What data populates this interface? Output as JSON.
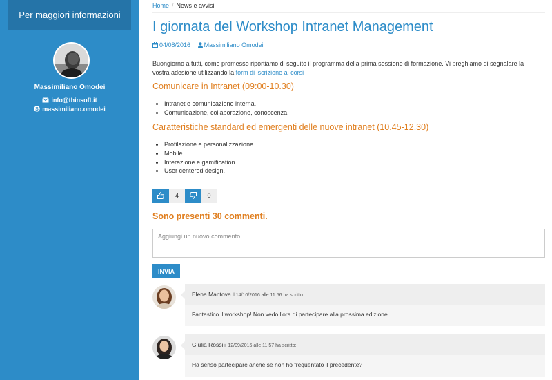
{
  "sidebar": {
    "header": "Per maggiori informazioni",
    "profile_name": "Massimiliano Omodei",
    "email": "info@thinsoft.it",
    "skype": "massimiliano.omodei",
    "accent": "#2d8cc8",
    "header_bg": "#2574a8"
  },
  "breadcrumb": {
    "home": "Home",
    "separator": "/",
    "current": "News e avvisi"
  },
  "article": {
    "title": "I giornata del Workshop Intranet Management",
    "date": "04/08/2016",
    "author": "Massimiliano Omodei",
    "intro_text": "Buongiorno a tutti, come promesso riportiamo di seguito il programma della prima sessione di formazione. Vi preghiamo di segnalare la vostra adesione utilizzando la ",
    "intro_link": "form di iscrizione ai corsi",
    "sections": [
      {
        "heading": "Comunicare in Intranet (09:00-10.30)",
        "items": [
          "Intranet e comunicazione interna.",
          "Comunicazione, collaborazione, conoscenza."
        ]
      },
      {
        "heading": "Caratteristiche standard ed emergenti delle nuove intranet (10.45-12.30)",
        "items": [
          "Profilazione e personalizzazione.",
          "Mobile.",
          "Interazione e gamification.",
          "User centered design."
        ]
      }
    ]
  },
  "votes": {
    "up_icon": "thumbs-up-icon",
    "up_count": "4",
    "down_icon": "thumbs-down-icon",
    "down_count": "0"
  },
  "comments": {
    "heading": "Sono presenti 30 commenti.",
    "input_placeholder": "Aggiungi un nuovo commento",
    "send_label": "INVIA",
    "list": [
      {
        "author": "Elena Mantova",
        "meta": " il 14/10/2016 alle 11:56 ha scritto:",
        "text": "Fantastico il workshop! Non vedo l'ora di partecipare alla prossima edizione."
      },
      {
        "author": "Giulia Rossi",
        "meta": " il 12/09/2016 alle 11:57 ha scritto:",
        "text": "Ha senso partecipare anche se non ho frequentato il precedente?"
      }
    ]
  },
  "colors": {
    "accent": "#2d8cc8",
    "heading_orange": "#e07f20"
  }
}
